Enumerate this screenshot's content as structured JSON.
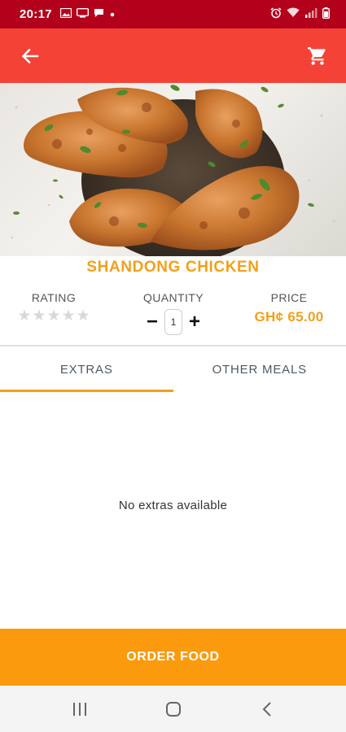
{
  "status_bar": {
    "time": "20:17",
    "left_icons": [
      "image-icon",
      "cast-icon",
      "chat-icon",
      "dot-icon"
    ],
    "right_icons": [
      "alarm-icon",
      "wifi-icon",
      "signal-icon",
      "battery-icon"
    ]
  },
  "app_bar": {
    "back_icon": "arrow-left-icon",
    "cart_icon": "cart-icon",
    "color": "#f44336"
  },
  "item": {
    "title": "SHANDONG CHICKEN",
    "rating_label": "RATING",
    "rating_value": 0,
    "rating_max": 5,
    "quantity_label": "QUANTITY",
    "quantity": "1",
    "decrement_symbol": "−",
    "increment_symbol": "+",
    "price_label": "PRICE",
    "price": "GH¢ 65.00"
  },
  "tabs": [
    {
      "label": "EXTRAS",
      "active": true
    },
    {
      "label": "OTHER MEALS",
      "active": false
    }
  ],
  "extras": {
    "empty_message": "No extras available"
  },
  "order_button": {
    "label": "ORDER FOOD",
    "color": "#fb9a0c"
  },
  "colors": {
    "status_bar": "#b3001b",
    "accent": "#f2a01b"
  },
  "nav_bar": {
    "icons": [
      "recent-apps-icon",
      "home-icon",
      "back-icon"
    ]
  }
}
